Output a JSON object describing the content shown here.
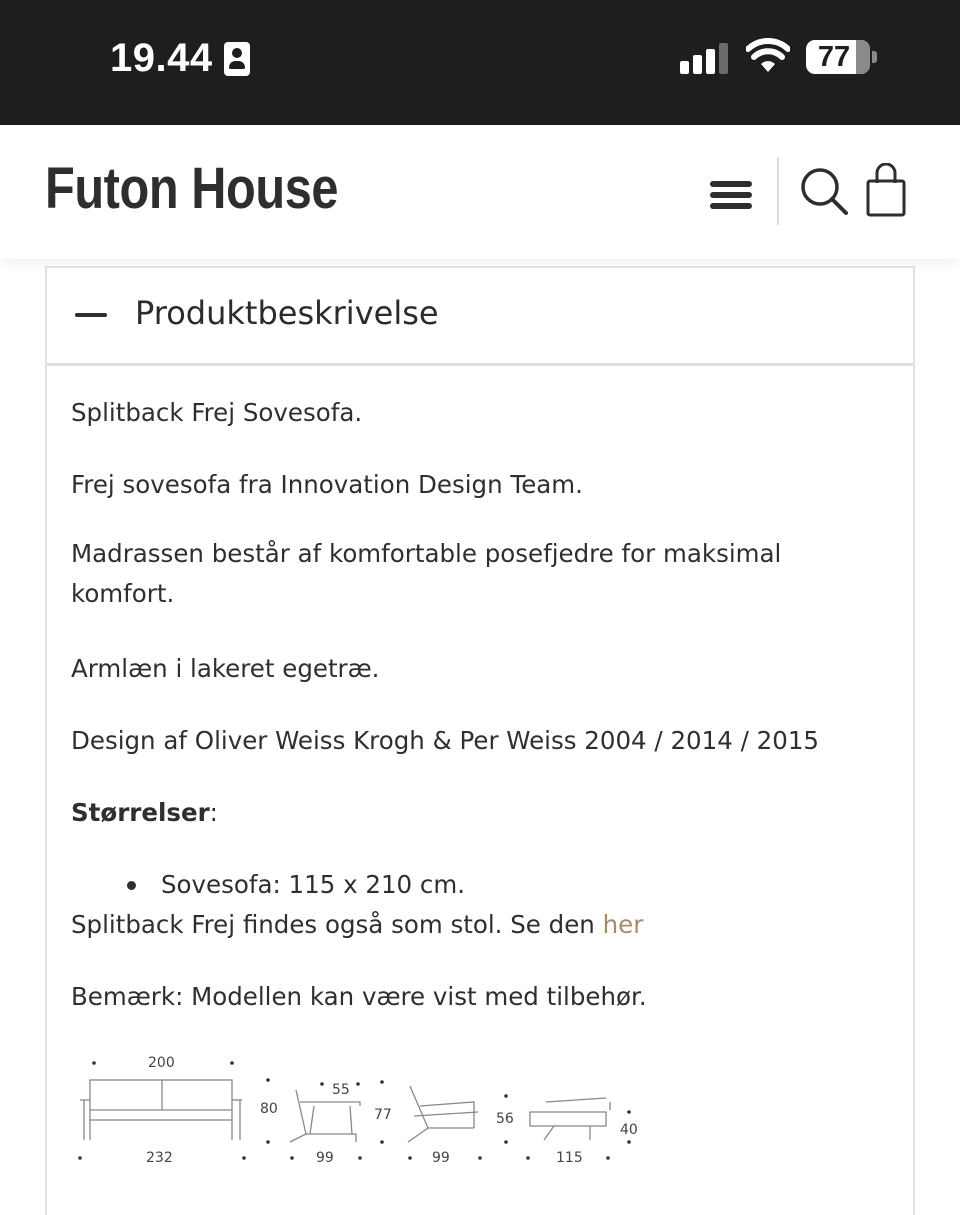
{
  "status_bar": {
    "time": "19.44",
    "battery_level": "77",
    "signal_bars_active": 3,
    "signal_bars_total": 4
  },
  "header": {
    "logo": "Futon House",
    "icons": [
      "menu-icon",
      "search-icon",
      "shopping-bag-icon"
    ]
  },
  "accordion": {
    "title": "Produktbeskrivelse",
    "expanded": true,
    "paragraphs": [
      "Splitback Frej Sovesofa.",
      "Frej sovesofa fra Innovation Design Team.",
      "Madrassen består af komfortable posefjedre for maksimal komfort.",
      "Armlæn i lakeret egetræ.",
      "Design af Oliver Weiss Krogh & Per Weiss 2004 / 2014 / 2015"
    ],
    "sizes_heading": "Størrelser",
    "sizes_heading_suffix": ":",
    "sizes": [
      "Sovesofa: 115 x 210 cm."
    ],
    "chair_text": "Splitback Frej findes også som stol. Se den ",
    "chair_link": "her",
    "note": "Bemærk: Modellen kan være vist med tilbehør.",
    "link_color": "#a88b6a"
  },
  "dimensions": {
    "sofa_width_top": "200",
    "sofa_width_bottom": "232",
    "sofa_height": "80",
    "side_seat_depth": "55",
    "side_height": "77",
    "side_depth": "99",
    "recline_depth": "99",
    "recline_height": "56",
    "bed_length": "115",
    "bed_height": "40"
  }
}
